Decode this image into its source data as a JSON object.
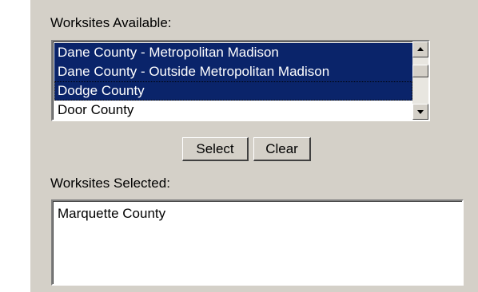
{
  "available": {
    "label": "Worksites Available:",
    "items": [
      {
        "text": "Dane County - Metropolitan Madison",
        "selected": true
      },
      {
        "text": "Dane County - Outside Metropolitan Madison",
        "selected": true
      },
      {
        "text": "Dodge County",
        "selected": true
      },
      {
        "text": "Door County",
        "selected": false
      }
    ]
  },
  "buttons": {
    "select_label": "Select",
    "clear_label": "Clear"
  },
  "selected": {
    "label": "Worksites Selected:",
    "value": "Marquette County"
  },
  "colors": {
    "panel_bg": "#d4d0c8",
    "selection_bg": "#0a246a",
    "selection_text": "#ffffff"
  },
  "icons": {
    "scroll_up": "arrow-up-icon",
    "scroll_down": "arrow-down-icon"
  }
}
